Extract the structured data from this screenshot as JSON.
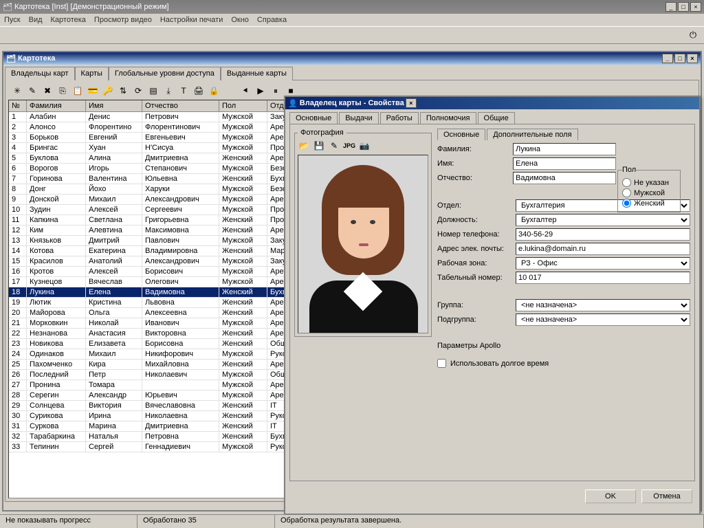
{
  "app": {
    "title": "Картотека [Inst] [Демонстрационный режим]"
  },
  "menu": [
    "Пуск",
    "Вид",
    "Картотека",
    "Просмотр видео",
    "Настройки печати",
    "Окно",
    "Справка"
  ],
  "card_window": {
    "title": "Картотека"
  },
  "main_tabs": [
    "Владельцы карт",
    "Карты",
    "Глобальные уровни доступа",
    "Выданные карты"
  ],
  "cols": {
    "n": "№",
    "fam": "Фамилия",
    "name": "Имя",
    "patr": "Отчество",
    "sex": "Пол",
    "dept": "Отд"
  },
  "rows": [
    {
      "n": "1",
      "f": "Алабин",
      "i": "Денис",
      "o": "Петрович",
      "p": "Мужской",
      "d": "Заку"
    },
    {
      "n": "2",
      "f": "Алонсо",
      "i": "Флорентино",
      "o": "Флорентинович",
      "p": "Мужской",
      "d": "Арен"
    },
    {
      "n": "3",
      "f": "Борьков",
      "i": "Евгений",
      "o": "Евгеньевич",
      "p": "Мужской",
      "d": "Арен"
    },
    {
      "n": "4",
      "f": "Брингас",
      "i": "Хуан",
      "o": "Н'Сисуа",
      "p": "Мужской",
      "d": "Прод"
    },
    {
      "n": "5",
      "f": "Буклова",
      "i": "Алина",
      "o": "Дмитриевна",
      "p": "Женский",
      "d": "Арен"
    },
    {
      "n": "6",
      "f": "Ворогов",
      "i": "Игорь",
      "o": "Степанович",
      "p": "Мужской",
      "d": "Безо"
    },
    {
      "n": "7",
      "f": "Горинова",
      "i": "Валентина",
      "o": "Юльевна",
      "p": "Женский",
      "d": "Бухг"
    },
    {
      "n": "8",
      "f": "Донг",
      "i": "Йохо",
      "o": "Харуки",
      "p": "Мужской",
      "d": "Безо"
    },
    {
      "n": "9",
      "f": "Донской",
      "i": "Михаил",
      "o": "Александрович",
      "p": "Мужской",
      "d": "Арен"
    },
    {
      "n": "10",
      "f": "Зудин",
      "i": "Алексей",
      "o": "Сергеевич",
      "p": "Мужской",
      "d": "Прод"
    },
    {
      "n": "11",
      "f": "Капкина",
      "i": "Светлана",
      "o": "Григорьевна",
      "p": "Женский",
      "d": "Прод"
    },
    {
      "n": "12",
      "f": "Ким",
      "i": "Алевтина",
      "o": "Максимовна",
      "p": "Женский",
      "d": "Арен"
    },
    {
      "n": "13",
      "f": "Князьков",
      "i": "Дмитрий",
      "o": "Павлович",
      "p": "Мужской",
      "d": "Заку"
    },
    {
      "n": "14",
      "f": "Котова",
      "i": "Екатерина",
      "o": "Владимировна",
      "p": "Женский",
      "d": "Марк"
    },
    {
      "n": "15",
      "f": "Красилов",
      "i": "Анатолий",
      "o": "Александрович",
      "p": "Мужской",
      "d": "Заку"
    },
    {
      "n": "16",
      "f": "Кротов",
      "i": "Алексей",
      "o": "Борисович",
      "p": "Мужской",
      "d": "Арен"
    },
    {
      "n": "17",
      "f": "Кузнецов",
      "i": "Вячеслав",
      "o": "Олегович",
      "p": "Мужской",
      "d": "Арен"
    },
    {
      "n": "18",
      "f": "Лукина",
      "i": "Елена",
      "o": "Вадимовна",
      "p": "Женский",
      "d": "Бухг"
    },
    {
      "n": "19",
      "f": "Лютик",
      "i": "Кристина",
      "o": "Львовна",
      "p": "Женский",
      "d": "Арен"
    },
    {
      "n": "20",
      "f": "Майорова",
      "i": "Ольга",
      "o": "Алексеевна",
      "p": "Женский",
      "d": "Арен"
    },
    {
      "n": "21",
      "f": "Морковкин",
      "i": "Николай",
      "o": "Иванович",
      "p": "Мужской",
      "d": "Арен"
    },
    {
      "n": "22",
      "f": "Незнанова",
      "i": "Анастасия",
      "o": "Викторовна",
      "p": "Женский",
      "d": "Арен"
    },
    {
      "n": "23",
      "f": "Новикова",
      "i": "Елизавета",
      "o": "Борисовна",
      "p": "Женский",
      "d": "Общ"
    },
    {
      "n": "24",
      "f": "Одинаков",
      "i": "Михаил",
      "o": "Никифорович",
      "p": "Мужской",
      "d": "Руко"
    },
    {
      "n": "25",
      "f": "Пахомченко",
      "i": "Кира",
      "o": "Михайловна",
      "p": "Женский",
      "d": "Арен"
    },
    {
      "n": "26",
      "f": "Последний",
      "i": "Петр",
      "o": "Николаевич",
      "p": "Мужской",
      "d": "Общ"
    },
    {
      "n": "27",
      "f": "Пронина",
      "i": "Томара",
      "o": "",
      "p": "Мужской",
      "d": "Арен"
    },
    {
      "n": "28",
      "f": "Серегин",
      "i": "Александр",
      "o": "Юрьевич",
      "p": "Мужской",
      "d": "Арен"
    },
    {
      "n": "29",
      "f": "Солнцева",
      "i": "Виктория",
      "o": "Вячеславовна",
      "p": "Женский",
      "d": "IT"
    },
    {
      "n": "30",
      "f": "Сурикова",
      "i": "Ирина",
      "o": "Николаевна",
      "p": "Женский",
      "d": "Руко"
    },
    {
      "n": "31",
      "f": "Суркова",
      "i": "Марина",
      "o": "Дмитриевна",
      "p": "Женский",
      "d": "IT"
    },
    {
      "n": "32",
      "f": "Тарабаркина",
      "i": "Наталья",
      "o": "Петровна",
      "p": "Женский",
      "d": "Бухг"
    },
    {
      "n": "33",
      "f": "Тепинин",
      "i": "Сергей",
      "o": "Геннадиевич",
      "p": "Мужской",
      "d": "Руко"
    }
  ],
  "selected_row": 17,
  "dlg": {
    "title": "Владелец карты - Свойства",
    "tabs": [
      "Основные",
      "Выдачи",
      "Работы",
      "Полномочия",
      "Общие"
    ],
    "photo_legend": "Фотография",
    "subtabs": [
      "Основные",
      "Дополнительные поля"
    ],
    "pol_legend": "Пол",
    "pol_opts": [
      "Не указан",
      "Мужской",
      "Женский"
    ],
    "labels": {
      "fam": "Фамилия:",
      "name": "Имя:",
      "patr": "Отчество:",
      "dept": "Отдел:",
      "job": "Должность:",
      "phone": "Номер телефона:",
      "email": "Адрес элек. почты:",
      "zone": "Рабочая зона:",
      "tabno": "Табельный номер:",
      "group": "Группа:",
      "subgroup": "Подгруппа:"
    },
    "vals": {
      "fam": "Лукина",
      "name": "Елена",
      "patr": "Вадимовна",
      "dept": "Бухгалтерия",
      "job": "Бухгалтер",
      "phone": "340-56-29",
      "email": "e.lukina@domain.ru",
      "zone": "РЗ - Офис",
      "tabno": "10 017",
      "group": "<не назначена>",
      "subgroup": "<не назначена>"
    },
    "apollo": "Параметры Apollo",
    "longtime": "Использовать долгое время",
    "ok": "OK",
    "cancel": "Отмена"
  },
  "status": {
    "left": "Не показывать прогресс",
    "mid": "Обработано 35",
    "right": "Обработка результата завершена."
  }
}
